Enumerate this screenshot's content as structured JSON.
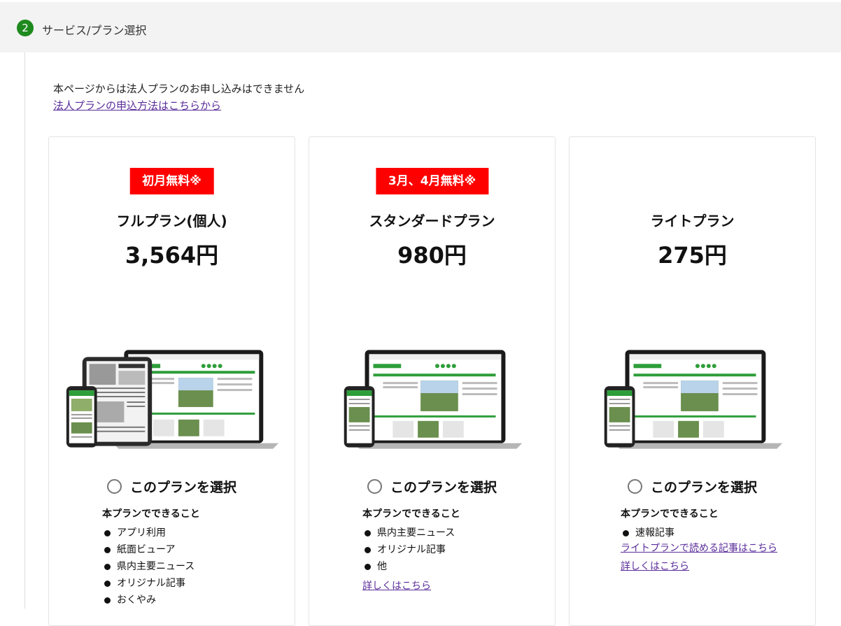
{
  "step": {
    "number": "2",
    "title": "サービス/プラン選択"
  },
  "notice": {
    "text": "本ページからは法人プランのお申し込みはできません",
    "link": "法人プランの申込方法はこちらから"
  },
  "plans": [
    {
      "badge": "初月無料※",
      "name": "フルプラン(個人)",
      "price": "3,564円",
      "select_label": "このプランを選択",
      "features_title": "本プランでできること",
      "features": [
        "アプリ利用",
        "紙面ビューア",
        "県内主要ニュース",
        "オリジナル記事",
        "おくやみ"
      ],
      "devices": "tablet-laptop-phone"
    },
    {
      "badge": "3月、4月無料※",
      "name": "スタンダードプラン",
      "price": "980円",
      "select_label": "このプランを選択",
      "features_title": "本プランでできること",
      "features": [
        "県内主要ニュース",
        "オリジナル記事",
        "他"
      ],
      "detail_link": "詳しくはこちら",
      "devices": "laptop-phone"
    },
    {
      "name": "ライトプラン",
      "price": "275円",
      "select_label": "このプランを選択",
      "features_title": "本プランでできること",
      "features": [
        "速報記事"
      ],
      "articles_link": "ライトプランで読める記事はこちら",
      "detail_link": "詳しくはこちら",
      "devices": "laptop-phone"
    }
  ],
  "colors": {
    "badge": "#ff0000",
    "step_circle": "#1e8a1e",
    "link": "#5a2d9a",
    "site_green": "#2e9e3a"
  }
}
